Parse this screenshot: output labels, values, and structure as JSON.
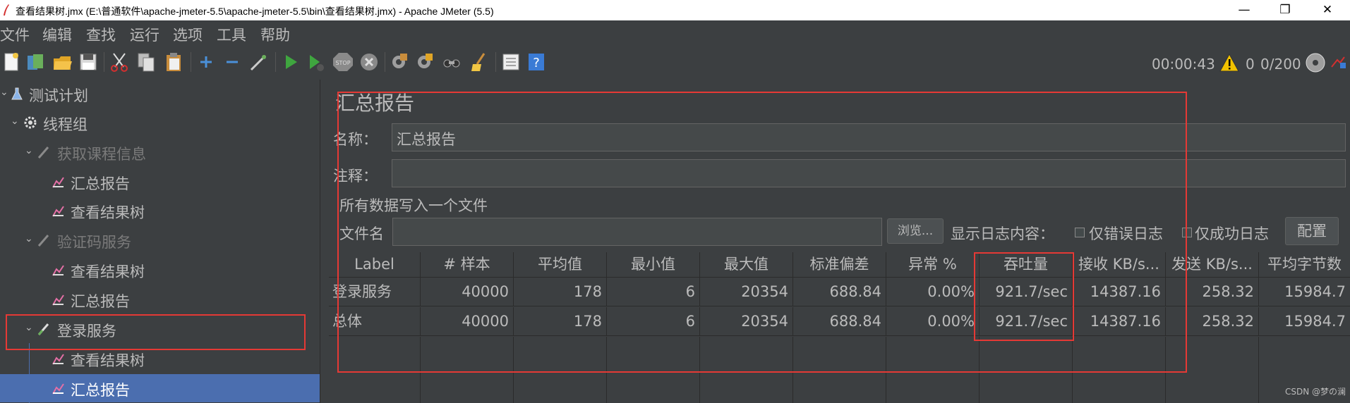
{
  "window": {
    "title": "查看结果树.jmx (E:\\普通软件\\apache-jmeter-5.5\\apache-jmeter-5.5\\bin\\查看结果树.jmx) - Apache JMeter (5.5)",
    "minimize": "—",
    "restore": "❐",
    "close": "✕"
  },
  "menu": [
    "文件",
    "编辑",
    "查找",
    "运行",
    "选项",
    "工具",
    "帮助"
  ],
  "toolbar": {
    "icons": [
      "new-icon",
      "templates-icon",
      "open-icon",
      "save-icon",
      "cut-icon",
      "copy-icon",
      "paste-icon",
      "expand-icon",
      "collapse-icon",
      "toggle-icon",
      "start-icon",
      "start-no-pause-icon",
      "stop-icon",
      "shutdown-icon",
      "clear-icon",
      "clear-all-icon",
      "search-icon",
      "reset-search-icon",
      "function-helper-icon",
      "help-icon"
    ],
    "timer": "00:00:43",
    "warnings": "0",
    "threads": "0/200"
  },
  "tree": [
    {
      "label": "测试计划",
      "icon": "flask-icon",
      "level": 0,
      "state": "normal"
    },
    {
      "label": "线程组",
      "icon": "gear-icon",
      "level": 1,
      "state": "normal"
    },
    {
      "label": "获取课程信息",
      "icon": "sampler-icon",
      "level": 2,
      "state": "disabled"
    },
    {
      "label": "汇总报告",
      "icon": "chart-icon",
      "level": 3,
      "state": "normal"
    },
    {
      "label": "查看结果树",
      "icon": "chart-icon",
      "level": 3,
      "state": "normal"
    },
    {
      "label": "验证码服务",
      "icon": "sampler-icon",
      "level": 2,
      "state": "disabled"
    },
    {
      "label": "查看结果树",
      "icon": "chart-icon",
      "level": 3,
      "state": "normal"
    },
    {
      "label": "汇总报告",
      "icon": "chart-icon",
      "level": 3,
      "state": "normal"
    },
    {
      "label": "登录服务",
      "icon": "sampler-icon",
      "level": 2,
      "state": "normal"
    },
    {
      "label": "查看结果树",
      "icon": "chart-icon",
      "level": 3,
      "state": "normal"
    },
    {
      "label": "汇总报告",
      "icon": "chart-icon",
      "level": 3,
      "state": "selected"
    }
  ],
  "panel": {
    "title": "汇总报告",
    "name_label": "名称：",
    "name_value": "汇总报告",
    "comment_label": "注释：",
    "comment_value": "",
    "file_section": "所有数据写入一个文件",
    "filename_label": "文件名",
    "filename_value": "",
    "browse": "浏览...",
    "log_label": "显示日志内容：",
    "errors_only": "仅错误日志",
    "success_only": "仅成功日志",
    "configure": "配置"
  },
  "table": {
    "headers": [
      "Label",
      "# 样本",
      "平均值",
      "最小值",
      "最大值",
      "标准偏差",
      "异常 %",
      "吞吐量",
      "接收 KB/s...",
      "发送 KB/s...",
      "平均字节数"
    ],
    "rows": [
      [
        "登录服务",
        "40000",
        "178",
        "6",
        "20354",
        "688.84",
        "0.00%",
        "921.7/sec",
        "14387.16",
        "258.32",
        "15984.7"
      ],
      [
        "总体",
        "40000",
        "178",
        "6",
        "20354",
        "688.84",
        "0.00%",
        "921.7/sec",
        "14387.16",
        "258.32",
        "15984.7"
      ]
    ]
  },
  "watermark": "CSDN @梦の澜",
  "colors": {
    "background": "#3c3f41",
    "selection": "#4b6eaf",
    "annotation": "#e53935"
  }
}
